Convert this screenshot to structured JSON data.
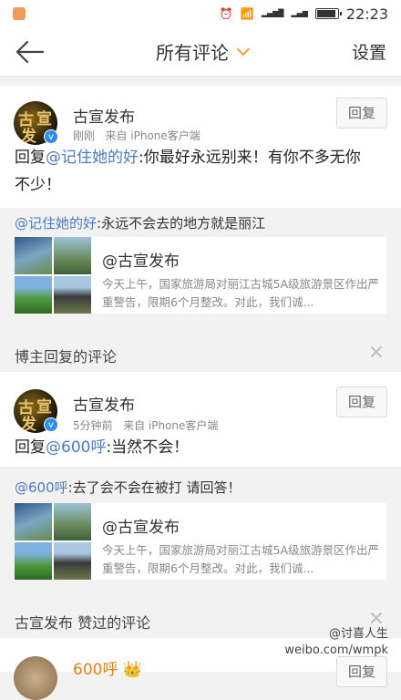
{
  "status": {
    "time": "22:23"
  },
  "header": {
    "title": "所有评论",
    "settings": "设置"
  },
  "comments": [
    {
      "name": "古宣发布",
      "time": "刚刚",
      "source": "来自 iPhone客户端",
      "reply_label": "回复",
      "text_prefix": "回复",
      "mention": "@记住她的好",
      "text_line1_rest": ":你最好永远别来！有你不多无你",
      "text_line2": "不少！",
      "quote_mention": "@记住她的好",
      "quote_text": ":永远不会去的地方就是丽江",
      "embed_title": "@古宣发布",
      "embed_desc": "今天上午，国家旅游局对丽江古城5A级旅游景区作出严重警告，限期6个月整改。对此，我们诚..."
    },
    {
      "name": "古宣发布",
      "time": "5分钟前",
      "source": "来自 iPhone客户端",
      "reply_label": "回复",
      "text_prefix": "回复",
      "mention": "@600呼",
      "text_rest": ":当然不会！",
      "quote_mention": "@600呼",
      "quote_text": ":去了会不会在被打 请回答！",
      "embed_title": "@古宣发布",
      "embed_desc": "今天上午，国家旅游局对丽江古城5A级旅游景区作出严重警告，限期6个月整改。对此，我们诚..."
    }
  ],
  "sections": {
    "blogger_replied": "博主回复的评论",
    "liked": "古宣发布 赞过的评论"
  },
  "bottom": {
    "name": "600呼",
    "reply_label": "回复"
  },
  "avatar_glyphs": [
    "古",
    "宣",
    "发"
  ],
  "watermark": {
    "line1": "@讨喜人生",
    "line2": "weibo.com/wmpk"
  }
}
